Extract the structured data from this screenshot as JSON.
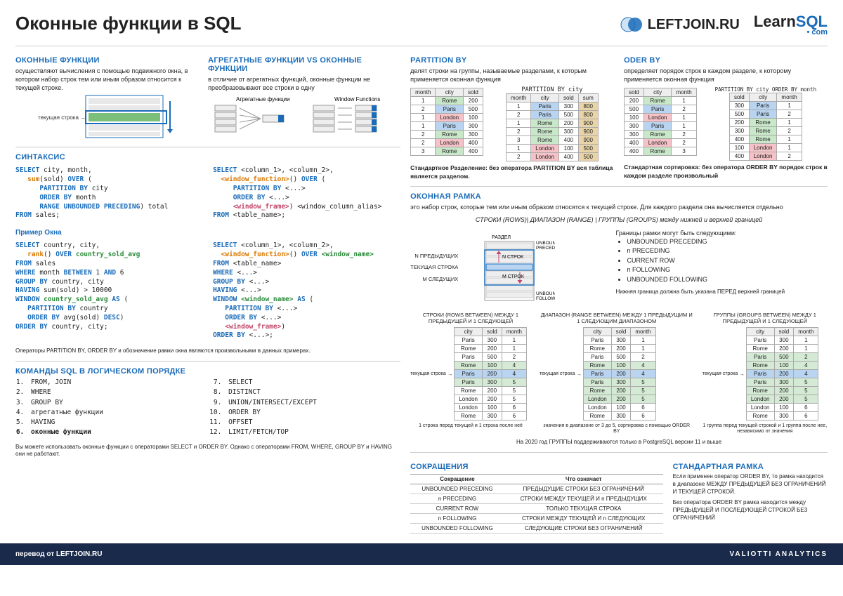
{
  "title": "Оконные функции в SQL",
  "logos": {
    "leftjoin": "LEFTJOIN.RU",
    "learn": "Learn",
    "sql": "SQL",
    "dotcom": "• com"
  },
  "s1": {
    "h": "ОКОННЫЕ ФУНКЦИИ",
    "p": "осуществляют вычисления с помощью подвижного окна, в котором набор строк тем или иным образом относится к текущей строке.",
    "cur": "текущая строка"
  },
  "s2": {
    "h": "АГРЕГАТНЫЕ ФУНКЦИИ VS ОКОННЫЕ ФУНКЦИИ",
    "p": "в отличие от агрегатных функций, оконные функции не преобразовывают все строки в одну",
    "l": "Агрегатные функции",
    "r": "Window Functions"
  },
  "s3": {
    "h": "PARTITION BY",
    "p": "делят строки на группы, называемые разделами, к которым применяется оконная функция",
    "code": "PARTITION BY city",
    "note": "Стандартное Разделение: без оператора PARTITION BY вся таблица является разделом."
  },
  "s4": {
    "h": "ODER BY",
    "p": "определяет порядок строк в каждом разделе, к которому применяется оконная функция",
    "code": "PARTITION BY city ORDER BY month",
    "note": "Стандартная сортировка: без оператора ORDER BY порядок строк в каждом разделе произвольный"
  },
  "s5": {
    "h": "СИНТАКСИС"
  },
  "s6": {
    "h": "Пример Окна"
  },
  "opnote": "Операторы PARTITION BY, ORDER BY и обозначение рамки окна являются произвольными в данных примерах.",
  "s7": {
    "h": "КОМАНДЫ SQL В ЛОГИЧЕСКОМ ПОРЯДКЕ",
    "items1": [
      "FROM, JOIN",
      "WHERE",
      "GROUP BY",
      "агрегатные функции",
      "HAVING",
      "оконные функции"
    ],
    "items2": [
      "SELECT",
      "DISTINCT",
      "UNION/INTERSECT/EXCEPT",
      "ORDER BY",
      "OFFSET",
      "LIMIT/FETCH/TOP"
    ],
    "note": "Вы можете использовать оконные функции с операторами SELECT и ORDER BY. Однако с операторами FROM, WHERE, GROUP BY и HAVING они не работают."
  },
  "s8": {
    "h": "ОКОННАЯ РАМКА",
    "p": "это набор строк, которые тем или иным образом относятся к текущей строке. Для каждого раздела она вычисляется отдельно",
    "types": "СТРОКИ (ROWS)| ДИАПАЗОН (RANGE) | ГРУППЫ (GROUPS) между нижней и верхней границей",
    "dl": {
      "part": "РАЗДЕЛ",
      "np": "N ПРЕДЫДУЩИХ",
      "cur": "ТЕКУЩАЯ СТРОКА",
      "mf": "M СЛЕДУЩИХ",
      "up": "UNBOUNDED PRECEDING",
      "uf": "UNBOUNDED FOLLOWING",
      "nr": "N СТРОК",
      "mr": "M СТРОК"
    },
    "bounds_h": "Границы рамки могут быть следующими:",
    "bounds": [
      "UNBOUNDED PRECEDING",
      "n PRECEDING",
      "CURRENT ROW",
      "n FOLLOWING",
      "UNBOUNDED FOLLOWING"
    ],
    "bnote": "Нижняя граница должна быть указана ПЕРЕД верхней границей"
  },
  "mini": {
    "t1": "СТРОКИ (ROWS BETWEEN) МЕЖДУ 1 ПРЕДЫДУЩЕЙ И 1 СЛЕДУЮЩЕЙ",
    "c1": "1 строка перед текущей и 1 строка после неё",
    "t2": "ДИАПАЗОН (RANGE BETWEEN) МЕЖДУ 1 ПРЕДЫДУЩИМ И 1 СЛЕДУЮЩИМ ДИАПАЗОНОМ",
    "c2": "значения в диапазоне от 3 до 5, сортировка с помощью ORDER BY",
    "t3": "ГРУППЫ (GROUPS BETWEEN) МЕЖДУ 1 ПРЕДЫДУЩЕЙ И 1 СЛЕДУЮЩЕЙ",
    "c3": "1 группа перед текущей строкой и 1 группа после нее, независимо от значения",
    "cur": "текущая строка",
    "pg": "На 2020 год ГРУППЫ поддерживаются только в PostgreSQL версии 11 и выше"
  },
  "s9": {
    "h": "СОКРАЩЕНИЯ",
    "th1": "Сокращение",
    "th2": "Что означает",
    "rows": [
      [
        "UNBOUNDED PRECEDING",
        "ПРЕДЫДУЩИЕ СТРОКИ БЕЗ ОГРАНИЧЕНИЙ"
      ],
      [
        "n PRECEDING",
        "СТРОКИ МЕЖДУ ТЕКУЩЕЙ И n ПРЕДЫДУЩИХ"
      ],
      [
        "CURRENT ROW",
        "ТОЛЬКО ТЕКУЩАЯ СТРОКА"
      ],
      [
        "n FOLLOWING",
        "СТРОКИ МЕЖДУ ТЕКУЩЕЙ И n СЛЕДУЮЩИХ"
      ],
      [
        "UNBOUNDED FOLLOWING",
        "СЛЕДУЮЩИЕ СТРОКИ БЕЗ ОГРАНИЧЕНИЙ"
      ]
    ]
  },
  "s10": {
    "h": "СТАНДАРТНАЯ РАМКА",
    "p1": "Если применен оператор ORDER BY, то рамка находится в диапазоне МЕЖДУ ПРЕДЫДУЩЕЙ БЕЗ ОГРАНИЧЕНИЙ И ТЕКУЩЕЙ СТРОКОЙ.",
    "p2": "Без оператора ORDER BY рамка находится между ПРЕДЫДУЩЕЙ И ПОСЛЕДУЮЩЕЙ СТРОКОЙ БЕЗ ОГРАНИЧЕНИЙ"
  },
  "footer": {
    "l": "перевод от LEFTJOIN.RU",
    "r": "VALIOTTI ANALYTICS"
  },
  "tbl": {
    "th": [
      "month",
      "city",
      "sold"
    ],
    "rows": [
      [
        "1",
        "Rome",
        "200"
      ],
      [
        "2",
        "Paris",
        "500"
      ],
      [
        "1",
        "London",
        "100"
      ],
      [
        "1",
        "Paris",
        "300"
      ],
      [
        "2",
        "Rome",
        "300"
      ],
      [
        "2",
        "London",
        "400"
      ],
      [
        "3",
        "Rome",
        "400"
      ]
    ]
  },
  "tbl2": {
    "th": [
      "month",
      "city",
      "sold",
      "sum"
    ],
    "rows": [
      [
        "1",
        "Paris",
        "300",
        "800"
      ],
      [
        "2",
        "Paris",
        "500",
        "800"
      ],
      [
        "1",
        "Rome",
        "200",
        "900"
      ],
      [
        "2",
        "Rome",
        "300",
        "900"
      ],
      [
        "3",
        "Rome",
        "400",
        "900"
      ],
      [
        "1",
        "London",
        "100",
        "500"
      ],
      [
        "2",
        "London",
        "400",
        "500"
      ]
    ]
  },
  "tbl3": {
    "th": [
      "sold",
      "city",
      "month"
    ],
    "rows": [
      [
        "200",
        "Rome",
        "1"
      ],
      [
        "500",
        "Paris",
        "2"
      ],
      [
        "100",
        "London",
        "1"
      ],
      [
        "300",
        "Paris",
        "1"
      ],
      [
        "300",
        "Rome",
        "2"
      ],
      [
        "400",
        "London",
        "2"
      ],
      [
        "400",
        "Rome",
        "3"
      ]
    ]
  },
  "tbl4": {
    "th": [
      "sold",
      "city",
      "month"
    ],
    "rows": [
      [
        "300",
        "Paris",
        "1"
      ],
      [
        "500",
        "Paris",
        "2"
      ],
      [
        "200",
        "Rome",
        "1"
      ],
      [
        "300",
        "Rome",
        "2"
      ],
      [
        "400",
        "Rome",
        "1"
      ],
      [
        "100",
        "London",
        "1"
      ],
      [
        "400",
        "London",
        "2"
      ]
    ]
  },
  "tblm": {
    "th": [
      "city",
      "sold",
      "month"
    ],
    "rows": [
      [
        "Paris",
        "300",
        "1"
      ],
      [
        "Rome",
        "200",
        "1"
      ],
      [
        "Paris",
        "500",
        "2"
      ],
      [
        "Rome",
        "100",
        "4"
      ],
      [
        "Paris",
        "200",
        "4"
      ],
      [
        "Paris",
        "300",
        "5"
      ],
      [
        "Rome",
        "200",
        "5"
      ],
      [
        "London",
        "200",
        "5"
      ],
      [
        "London",
        "100",
        "6"
      ],
      [
        "Rome",
        "300",
        "6"
      ]
    ]
  }
}
